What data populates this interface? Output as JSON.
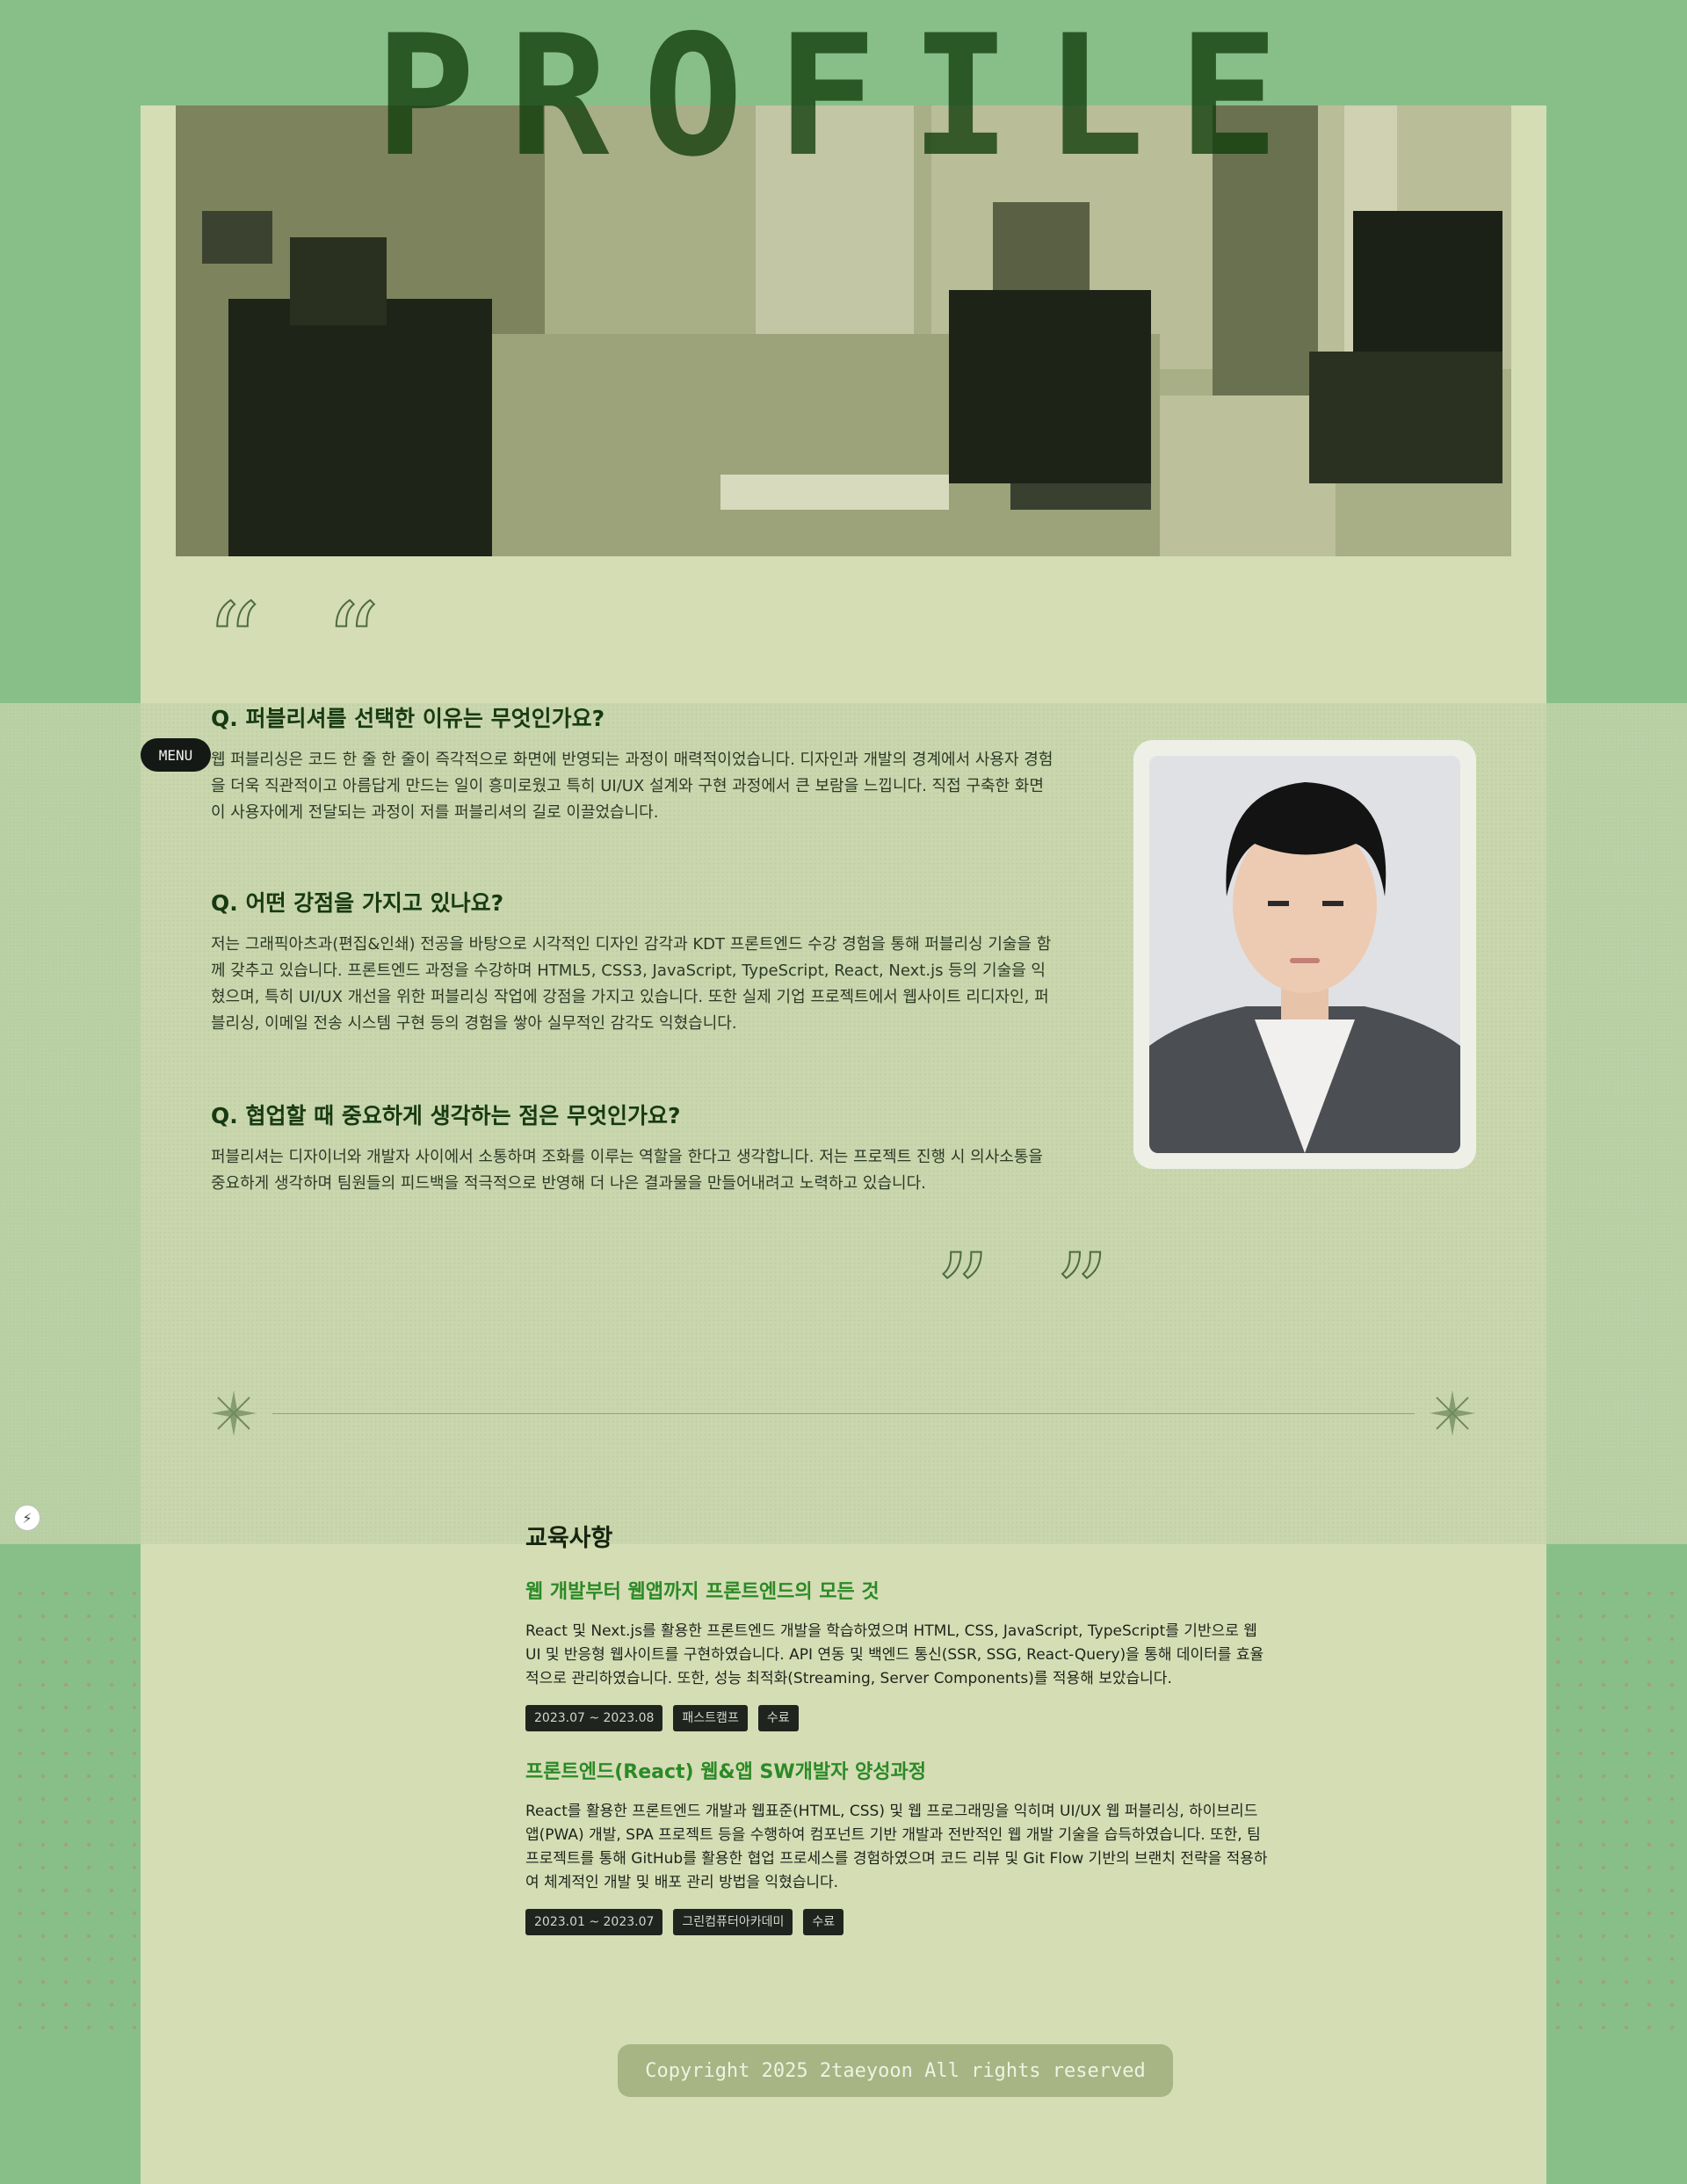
{
  "title": "PROFILE",
  "menu_label": "MENU",
  "quotes": {
    "open": "“ “",
    "close": "” ”"
  },
  "qa": [
    {
      "question": "Q. 퍼블리셔를 선택한 이유는 무엇인가요?",
      "answer": "웹 퍼블리싱은 코드 한 줄 한 줄이 즉각적으로 화면에 반영되는 과정이 매력적이었습니다. 디자인과 개발의 경계에서 사용자 경험을 더욱 직관적이고 아름답게 만드는 일이 흥미로웠고 특히 UI/UX 설계와 구현 과정에서 큰 보람을 느낍니다. 직접 구축한 화면이 사용자에게 전달되는 과정이 저를 퍼블리셔의 길로 이끌었습니다."
    },
    {
      "question": "Q. 어떤 강점을 가지고 있나요?",
      "answer": "저는 그래픽아츠과(편집&인쇄) 전공을 바탕으로 시각적인 디자인 감각과 KDT 프론트엔드 수강 경험을 통해 퍼블리싱 기술을 함께 갖추고 있습니다. 프론트엔드 과정을 수강하며 HTML5, CSS3, JavaScript, TypeScript, React, Next.js 등의 기술을 익혔으며, 특히 UI/UX 개선을 위한 퍼블리싱 작업에 강점을 가지고 있습니다. 또한 실제 기업 프로젝트에서 웹사이트 리디자인, 퍼블리싱, 이메일 전송 시스템 구현 등의 경험을 쌓아 실무적인 감각도 익혔습니다."
    },
    {
      "question": "Q. 협업할 때 중요하게 생각하는 점은 무엇인가요?",
      "answer": "퍼블리셔는 디자이너와 개발자 사이에서 소통하며 조화를 이루는 역할을 한다고 생각합니다. 저는 프로젝트 진행 시 의사소통을 중요하게 생각하며 팀원들의 피드백을 적극적으로 반영해 더 나은 결과물을 만들어내려고 노력하고 있습니다."
    }
  ],
  "education": {
    "heading": "교육사항",
    "courses": [
      {
        "title": "웹 개발부터 웹앱까지 프론트엔드의 모든 것",
        "description": "React 및 Next.js를 활용한 프론트엔드 개발을 학습하였으며 HTML, CSS, JavaScript, TypeScript를 기반으로 웹 UI 및 반응형 웹사이트를 구현하였습니다. API 연동 및 백엔드 통신(SSR, SSG, React-Query)을 통해 데이터를 효율적으로 관리하였습니다. 또한, 성능 최적화(Streaming, Server Components)를 적용해 보았습니다.",
        "tags": [
          "2023.07 ~ 2023.08",
          "패스트캠프",
          "수료"
        ]
      },
      {
        "title": "프론트엔드(React) 웹&앱 SW개발자 양성과정",
        "description": "React를 활용한 프론트엔드 개발과 웹표준(HTML, CSS) 및 웹 프로그래밍을 익히며 UI/UX 웹 퍼블리싱, 하이브리드 앱(PWA) 개발, SPA 프로젝트 등을 수행하여 컴포넌트 기반 개발과 전반적인 웹 개발 기술을 습득하였습니다. 또한, 팀 프로젝트를 통해 GitHub를 활용한 협업 프로세스를 경험하였으며 코드 리뷰 및 Git Flow 기반의 브랜치 전략을 적용하여 체계적인 개발 및 배포 관리 방법을 익혔습니다.",
        "tags": [
          "2023.01 ~ 2023.07",
          "그린컴퓨터아카데미",
          "수료"
        ]
      }
    ]
  },
  "footer": {
    "copyright": "Copyright 2025 2taeyoon All rights reserved"
  },
  "colors": {
    "page_bg": "#88bf89",
    "panel": "#d5ddb5",
    "title": "#0f3c0a",
    "course_title": "#2b8a26",
    "tag_bg": "#1f241f",
    "copyright_bg": "#a6b583"
  },
  "icons": {
    "open_quote": "open-quote-icon",
    "close_quote": "close-quote-icon",
    "sparkle": "sparkle-icon",
    "bolt": "lightning-icon"
  }
}
